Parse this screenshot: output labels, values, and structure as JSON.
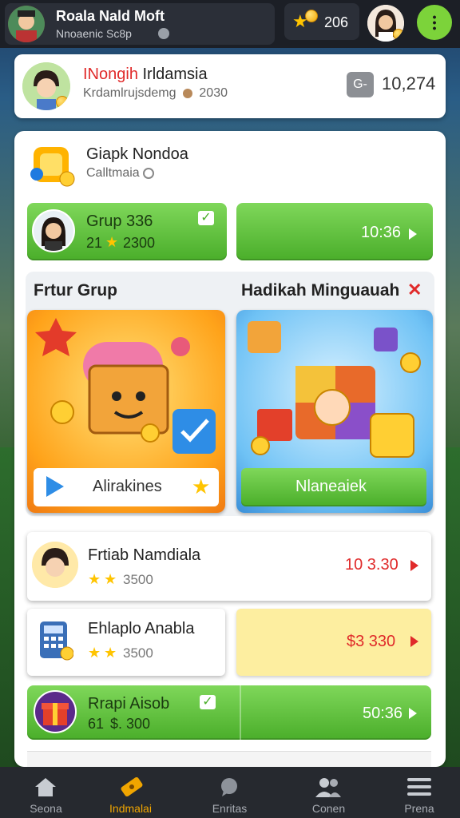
{
  "header": {
    "name": "Roala Nald Moft",
    "subtitle": "Nnoaenic Sc8p",
    "coins": "206"
  },
  "profile": {
    "title_red": "INongih",
    "title_rest": " Irldamsia",
    "subtitle": "Krdamlrujsdemg",
    "subvalue": "2030",
    "badge": "G-",
    "points": "10,274"
  },
  "group": {
    "title": "Giapk Nondoa",
    "subtitle": "Calltmaia",
    "row": {
      "name": "Grup 336",
      "level": "21",
      "score": "2300",
      "time": "10:36"
    }
  },
  "features": {
    "left_title": "Frtur Grup",
    "right_title": "Hadikah Minguauah",
    "left_button": "Alirakines",
    "right_button": "Nlaneaiek"
  },
  "list": [
    {
      "name": "Frtiab Namdiala",
      "score": "3500",
      "value": "10 3.30",
      "value_color": "#e02a2a"
    },
    {
      "name": "Ehlaplo Anabla",
      "score": "3500",
      "value": "$3 330",
      "value_color": "#e02a2a"
    },
    {
      "name": "Rrapi Aisob",
      "score": "$. 300",
      "level": "61",
      "value": "50:36",
      "value_color": "#ffffff"
    }
  ],
  "nav": [
    {
      "label": "Seona",
      "icon": "home-icon"
    },
    {
      "label": "Indmalai",
      "icon": "ticket-icon"
    },
    {
      "label": "Enritas",
      "icon": "chat-icon"
    },
    {
      "label": "Conen",
      "icon": "people-icon"
    },
    {
      "label": "Prena",
      "icon": "menu-icon"
    }
  ],
  "colors": {
    "accent_green": "#4aae2a",
    "accent_red": "#e02a2a",
    "gold": "#ffc400"
  }
}
